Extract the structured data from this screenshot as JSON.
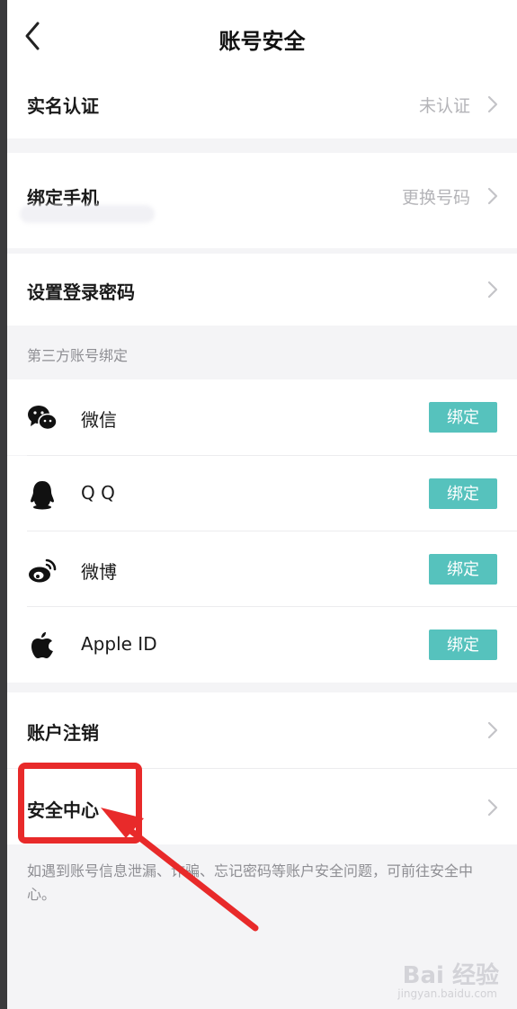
{
  "nav": {
    "title": "账号安全"
  },
  "account_rows": [
    {
      "label": "实名认证",
      "value": "未认证"
    },
    {
      "label": "绑定手机",
      "value": "更换号码"
    },
    {
      "label": "设置登录密码",
      "value": ""
    }
  ],
  "third_party": {
    "header": "第三方账号绑定",
    "items": [
      {
        "name": "微信",
        "icon": "wechat-icon",
        "button": "绑定"
      },
      {
        "name": "Q Q",
        "icon": "qq-icon",
        "button": "绑定"
      },
      {
        "name": "微博",
        "icon": "weibo-icon",
        "button": "绑定"
      },
      {
        "name": "Apple ID",
        "icon": "apple-icon",
        "button": "绑定"
      }
    ]
  },
  "other_rows": [
    {
      "label": "账户注销"
    },
    {
      "label": "安全中心"
    }
  ],
  "footer_note": "如遇到账号信息泄漏、诈骗、忘记密码等账户安全问题，可前往安全中心。",
  "watermark": {
    "brand": "Bai 经验",
    "url": "jingyan.baidu.com"
  },
  "colors": {
    "accent": "#56c2bd",
    "annotation": "#e82a2a",
    "background": "#f4f4f6"
  }
}
